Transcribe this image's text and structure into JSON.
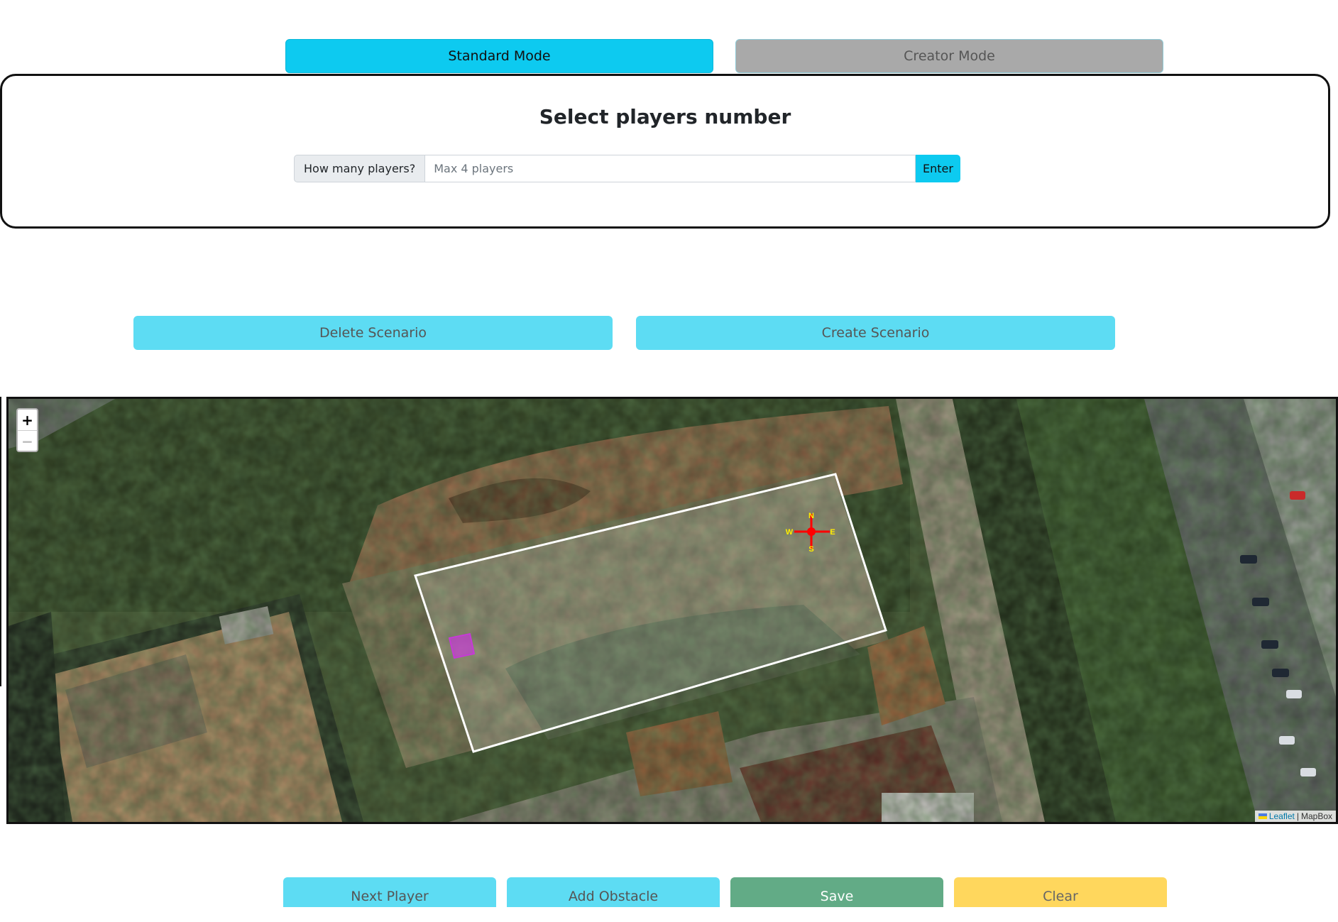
{
  "modes": {
    "standard_label": "Standard Mode",
    "creator_label": "Creator Mode"
  },
  "players_panel": {
    "title": "Select players number",
    "prefix_label": "How many players?",
    "input_placeholder": "Max 4 players",
    "input_value": "",
    "enter_label": "Enter"
  },
  "scenario": {
    "delete_label": "Delete Scenario",
    "create_label": "Create Scenario"
  },
  "map": {
    "zoom_in_label": "+",
    "zoom_out_label": "−",
    "compass": {
      "n": "N",
      "s": "S",
      "e": "E",
      "w": "W"
    },
    "attribution": {
      "leaflet_label": "Leaflet",
      "separator": "|",
      "provider_label": "MapBox"
    }
  },
  "actions": {
    "next_player_label": "Next Player",
    "add_obstacle_label": "Add Obstacle",
    "save_label": "Save",
    "clear_label": "Clear"
  },
  "colors": {
    "primary": "#0dcaf0",
    "light_primary": "#5ddcf3",
    "creator_inactive": "#a9a9a9",
    "save": "#62ab86",
    "clear": "#ffd75d",
    "player_marker": "#c63ad6",
    "compass": "#ff0000"
  }
}
